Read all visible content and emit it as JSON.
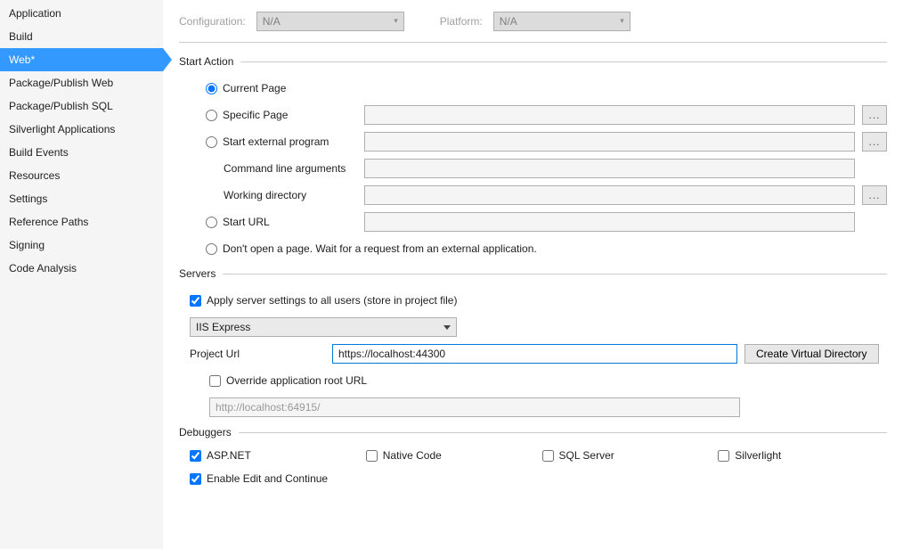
{
  "sidebar": {
    "items": [
      {
        "label": "Application"
      },
      {
        "label": "Build"
      },
      {
        "label": "Web*",
        "active": true
      },
      {
        "label": "Package/Publish Web"
      },
      {
        "label": "Package/Publish SQL"
      },
      {
        "label": "Silverlight Applications"
      },
      {
        "label": "Build Events"
      },
      {
        "label": "Resources"
      },
      {
        "label": "Settings"
      },
      {
        "label": "Reference Paths"
      },
      {
        "label": "Signing"
      },
      {
        "label": "Code Analysis"
      }
    ]
  },
  "topbar": {
    "configuration_label": "Configuration:",
    "configuration_value": "N/A",
    "platform_label": "Platform:",
    "platform_value": "N/A"
  },
  "start_action": {
    "title": "Start Action",
    "radio_current_page": "Current Page",
    "radio_specific_page": "Specific Page",
    "specific_page_value": "",
    "radio_external_program": "Start external program",
    "external_program_value": "",
    "cmd_args_label": "Command line arguments",
    "cmd_args_value": "",
    "working_dir_label": "Working directory",
    "working_dir_value": "",
    "radio_start_url": "Start URL",
    "start_url_value": "",
    "radio_dont_open": "Don't open a page.  Wait for a request from an external application.",
    "selected": "current_page"
  },
  "servers": {
    "title": "Servers",
    "apply_all_users_label": "Apply server settings to all users (store in project file)",
    "apply_all_users_checked": true,
    "server_dropdown_value": "IIS Express",
    "project_url_label": "Project Url",
    "project_url_value": "https://localhost:44300",
    "create_vdir_label": "Create Virtual Directory",
    "override_root_label": "Override application root URL",
    "override_root_checked": false,
    "override_root_value": "http://localhost:64915/"
  },
  "debuggers": {
    "title": "Debuggers",
    "aspnet_label": "ASP.NET",
    "aspnet_checked": true,
    "native_label": "Native Code",
    "native_checked": false,
    "sql_label": "SQL Server",
    "sql_checked": false,
    "silverlight_label": "Silverlight",
    "silverlight_checked": false,
    "enc_label": "Enable Edit and Continue",
    "enc_checked": true
  }
}
